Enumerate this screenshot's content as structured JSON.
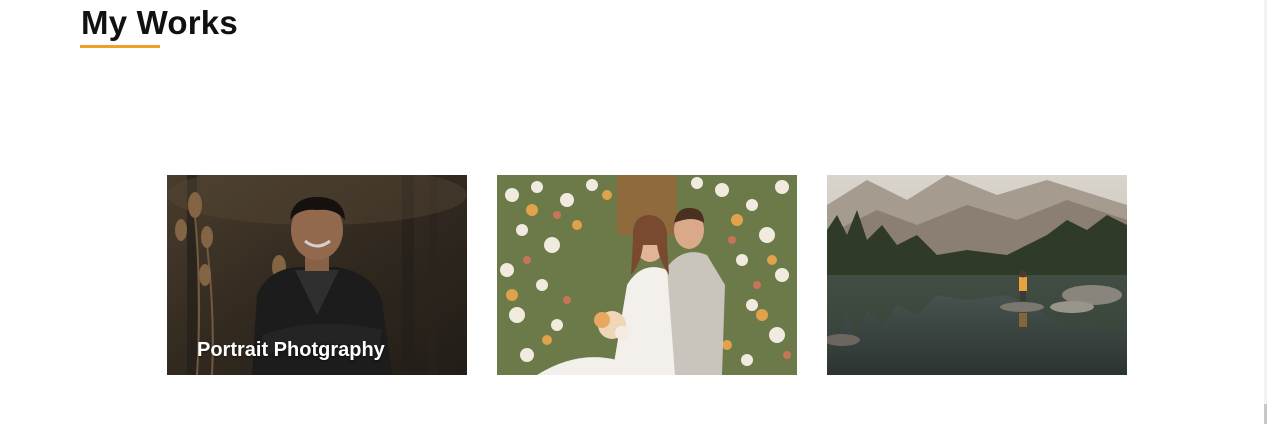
{
  "section": {
    "title": "My Works",
    "underline_color": "#f0a125"
  },
  "gallery": {
    "items": [
      {
        "caption": "Portrait Photgraphy",
        "image": "portrait-photo"
      },
      {
        "caption": "",
        "image": "wedding-couple-photo"
      },
      {
        "caption": "",
        "image": "mountain-lake-photo"
      }
    ]
  }
}
